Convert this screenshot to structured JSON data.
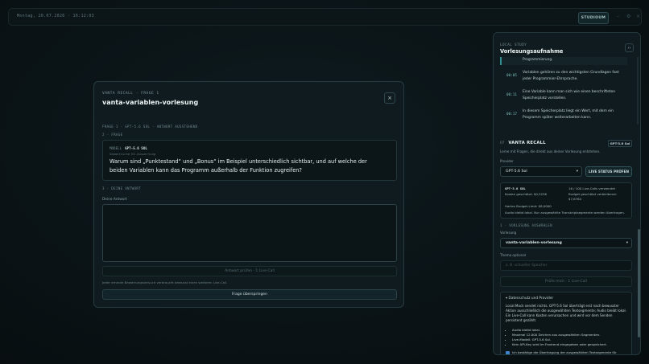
{
  "topbar": {
    "datetime": "Montag, 20.07.2026 · 16:12:03",
    "studio_label": "STUDIOUM"
  },
  "modal": {
    "eyebrow": "VANTA RECALL · FRAGE 1",
    "title": "vanta-variablen-vorlesung",
    "close_glyph": "×",
    "meta": "FRAGE 1 · GPT-5.6 SOL · ANTWORT AUSSTEHEND",
    "section_question": "2 · FRAGE",
    "question_model_prefix": "MODELL",
    "question_model": "GPT-5.6 SOL",
    "question_subtitle": "Semantische KI-Auswertung",
    "question_text": "Warum sind „Punktestand“ und „Bonus“ im Beispiel unterschiedlich sichtbar, und auf welche der beiden Variablen kann das Programm außerhalb der Funktion zugreifen?",
    "section_answer": "3 · DEINE ANTWORT",
    "answer_label": "Deine Antwort",
    "answer_value": "",
    "check_button": "Antwort prüfen · 1 Live-Call",
    "hint": "Jeder erneute Bewertungsversuch verbraucht bewusst einen weiteren Live-Call.",
    "skip_button": "Frage überspringen"
  },
  "panel": {
    "eyebrow": "LOCAL STUDY",
    "title": "Vorlesungsaufnahme",
    "toggle_glyph": "‹›",
    "transcript_first": "Programmierung.",
    "transcript": [
      {
        "time": "00:05",
        "text": "Variablen gehören zu den wichtigsten Grundlagen fast jeder Programmier-Ehrsprache."
      },
      {
        "time": "00:11",
        "text": "Eine Variable kann man sich wie einen beschrifteten Speicherplatz vorstellen."
      },
      {
        "time": "00:17",
        "text": "In diesem Speicherplatz liegt ein Wert, mit dem ein Programm später weiterarbeiten kann."
      }
    ],
    "recall_prefix": "07",
    "recall_title": "VANTA RECALL",
    "recall_badge": "GPT-5.6 Sol",
    "recall_desc": "Lerne mit Fragen, die direkt aus deiner Vorlesung entstehen.",
    "provider_label": "Provider",
    "provider_value": "GPT-5.6 Sol",
    "status_button": "LIVE STATUS PRÜFEN",
    "info": {
      "model": "GPT-5.6 SOL",
      "calls": "16 / 100 Live-Calls verwendet",
      "cost": "Kosten geschätzt: $0,5236",
      "budget_left": "Budget geschätzt verbleibend:",
      "budget_value": "$7,6764",
      "limit": "Hartes Budget-Limit: $8,0000",
      "audio_note": "Audio bleibt lokal. Nur ausgewählte Transkriptsegmente werden übertragen."
    },
    "section_choose": "1 · VORLESUNG AUSWÄHLEN",
    "lecture_label": "Vorlesung",
    "lecture_value": "vanta-variablen-vorlesung",
    "theme_label": "Thema optional",
    "theme_placeholder": "z. B. schueller Speicher",
    "quiz_button": "Prüfe mich · 1 Live-Call",
    "privacy_summary": "▾ Datenschutz und Provider",
    "privacy_text": "Local Mock sendet nichts. GPT-5.6 Sol überträgt erst nach bewusster Aktion ausschließlich die ausgewählten Textsegmente; Audio bleibt lokal. Ein Live-Call kann Kosten verursachen und wird vor dem Senden persistent gezählt.",
    "privacy_list": [
      "Audio bleibt lokal.",
      "Maximal 12.000 Zeichen aus ausgewählten Segmenten.",
      "Live-Modell: GPT-5.6 Sol.",
      "Kein API-Key wird im Frontend eingegeben oder gespeichert."
    ],
    "consent": "Ich bestätige die Übertragung der ausgewählten Textsegmente für"
  }
}
